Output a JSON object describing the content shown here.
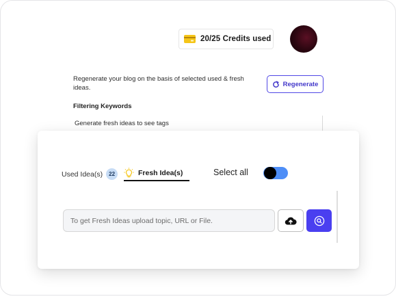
{
  "header": {
    "credits_label": "20/25 Credits used"
  },
  "regenerate": {
    "description": "Regenerate your blog on the basis of selected used & fresh ideas.",
    "button_label": "Regenerate"
  },
  "filtering": {
    "title": "Filtering Keywords",
    "empty_hint": "Generate fresh ideas to see tags"
  },
  "ideas_panel": {
    "tabs": [
      {
        "label": "Used Idea(s)",
        "count": "22"
      },
      {
        "label": "Fresh Idea(s)"
      }
    ],
    "active_tab": "Fresh Idea(s)",
    "select_all_label": "Select all",
    "select_all_enabled": true,
    "search": {
      "placeholder": "To get Fresh Ideas upload topic, URL or File.",
      "value": ""
    }
  },
  "colors": {
    "accent": "#4a3ff0",
    "toggle_on": "#4e8ef7",
    "badge_bg": "#c7dcf5",
    "credit_icon": "#f5c518"
  },
  "icons": [
    "credit-card-icon",
    "regenerate-icon",
    "lightbulb-icon",
    "cloud-upload-icon",
    "search-icon"
  ]
}
